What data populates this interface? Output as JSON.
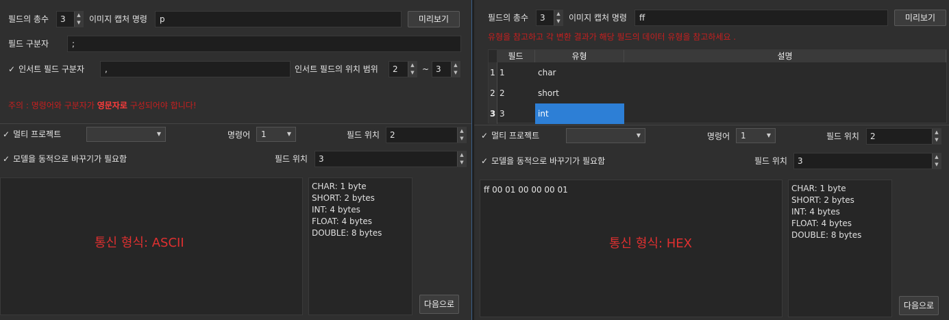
{
  "left": {
    "field_count_label": "필드의 총수",
    "field_count_value": "3",
    "capture_cmd_label": "이미지 캡처 명령",
    "capture_cmd_value": "p",
    "preview_button": "미리보기",
    "field_sep_label": "필드 구분자",
    "field_sep_value": ";",
    "insert_sep_label": "인서트 필드 구분자",
    "insert_sep_value": ",",
    "insert_range_label": "인서트 필드의 위치 범위",
    "range_from": "2",
    "range_tilde": "~",
    "range_to": "3",
    "warning_prefix": "주의 : 명령어와 구분자가 ",
    "warning_bold": "영문자로",
    "warning_suffix": " 구성되어야 합니다!",
    "multi_project_label": "멀티 프로젝트",
    "command_label": "명령어",
    "command_value": "1",
    "field_pos_label": "필드 위치",
    "field_pos_value": "2",
    "model_dynamic_label": "모델을 동적으로 바꾸기가 필요함",
    "field_pos2_label": "필드 위치",
    "field_pos2_value": "3",
    "protocol_text": "통신 형식: ASCII",
    "info_lines": [
      "CHAR: 1 byte",
      "SHORT: 2 bytes",
      "INT: 4 bytes",
      "FLOAT: 4 bytes",
      "DOUBLE: 8 bytes"
    ],
    "next_button": "다음으로"
  },
  "right": {
    "field_count_label": "필드의 총수",
    "field_count_value": "3",
    "capture_cmd_label": "이미지 캡처 명령",
    "capture_cmd_value": "ff",
    "preview_button": "미리보기",
    "warning": "유형을 참고하고 각 변환 결과가 해당 필드의 데이터 유형을 참고하세요 .",
    "table": {
      "headers": [
        "필드",
        "유형",
        "설명"
      ],
      "rows": [
        {
          "num": "1",
          "field": "1",
          "type": "char"
        },
        {
          "num": "2",
          "field": "2",
          "type": "short"
        },
        {
          "num": "3",
          "field": "3",
          "type": "int"
        }
      ]
    },
    "multi_project_label": "멀티 프로젝트",
    "command_label": "명령어",
    "command_value": "1",
    "field_pos_label": "필드 위치",
    "field_pos_value": "2",
    "model_dynamic_label": "모델을 동적으로 바꾸기가 필요함",
    "field_pos2_label": "필드 위치",
    "field_pos2_value": "3",
    "hex_preview": "ff 00 01 00 00 00 01",
    "protocol_text": "통신 형식: HEX",
    "info_lines": [
      "CHAR: 1 byte",
      "SHORT: 2 bytes",
      "INT: 4 bytes",
      "FLOAT: 4 bytes",
      "DOUBLE: 8 bytes"
    ],
    "next_button": "다음으로"
  },
  "colors": {
    "accent": "#2d7fd6",
    "warning": "#c81f1f",
    "protocol": "#e03030"
  },
  "icons": {
    "check": "check-icon",
    "spin": "spin-arrows-icon",
    "dropdown": "chevron-down-icon"
  }
}
